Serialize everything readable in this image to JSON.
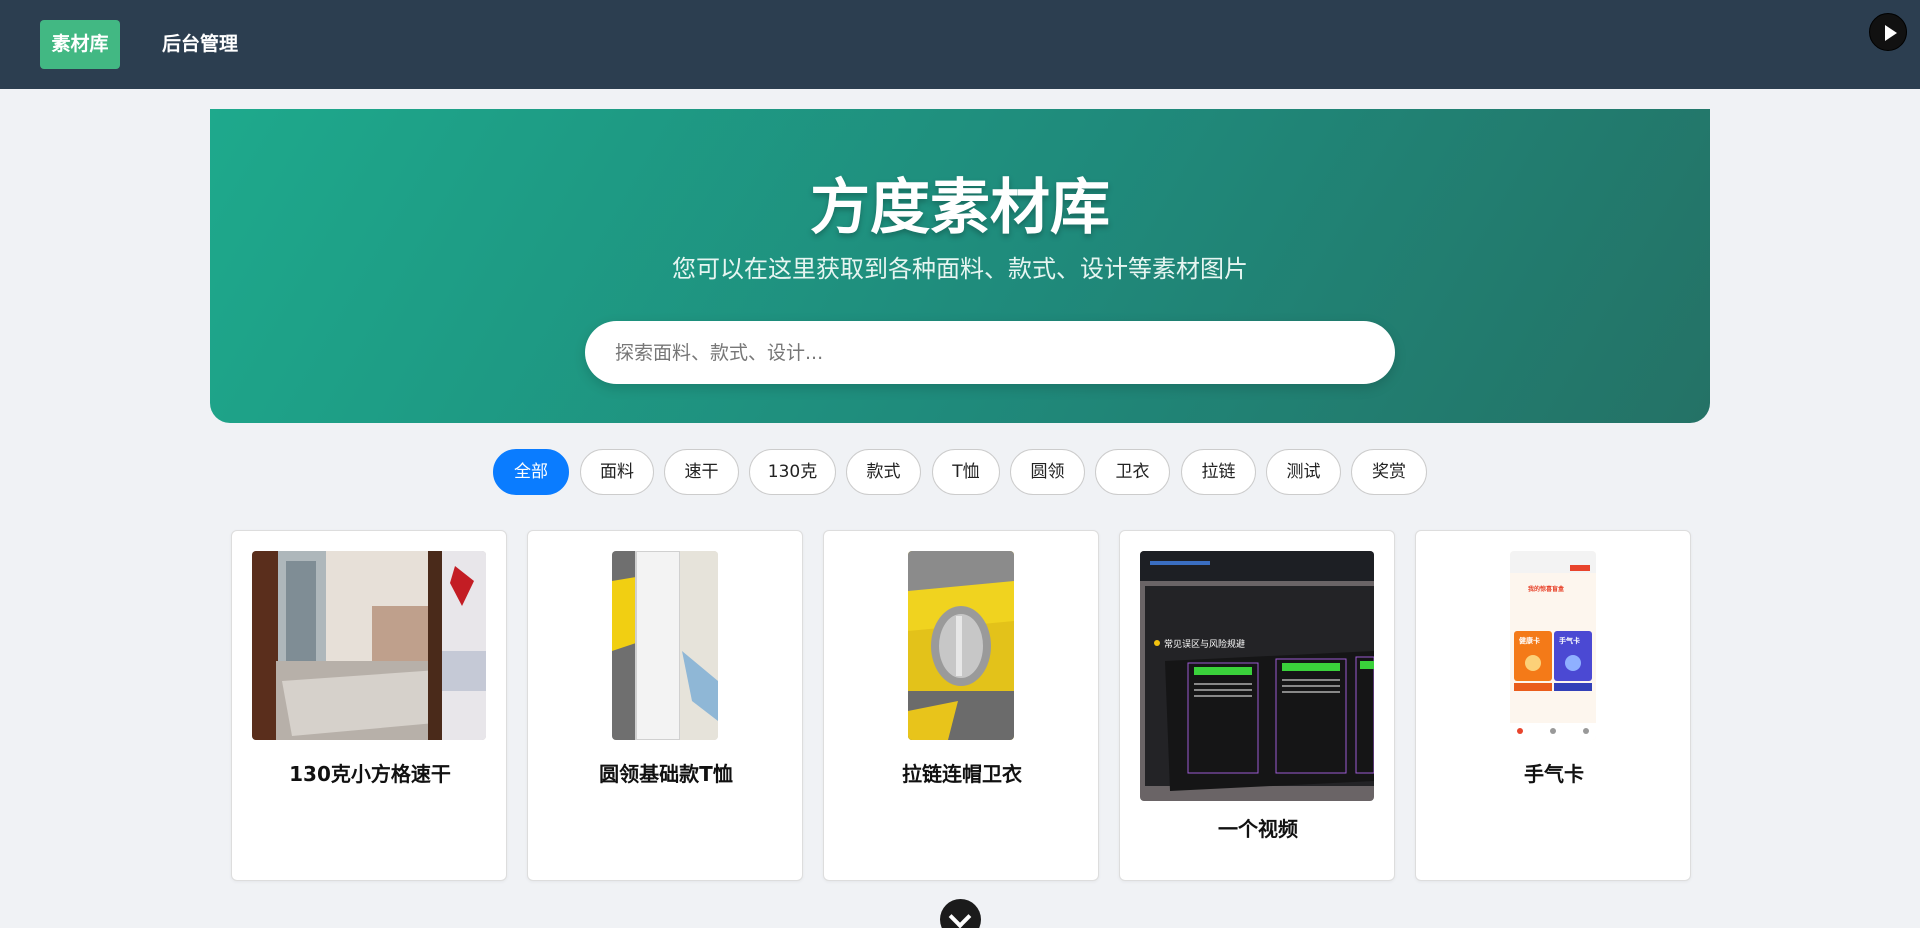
{
  "nav": {
    "items": [
      {
        "label": "素材库",
        "active": true
      },
      {
        "label": "后台管理",
        "active": false
      }
    ],
    "play_icon": "play-icon"
  },
  "hero": {
    "title": "方度素材库",
    "subtitle": "您可以在这里获取到各种面料、款式、设计等素材图片",
    "search_placeholder": "探索面料、款式、设计..."
  },
  "filters": [
    {
      "label": "全部",
      "active": true
    },
    {
      "label": "面料",
      "active": false
    },
    {
      "label": "速干",
      "active": false
    },
    {
      "label": "130克",
      "active": false
    },
    {
      "label": "款式",
      "active": false
    },
    {
      "label": "T恤",
      "active": false
    },
    {
      "label": "圆领",
      "active": false
    },
    {
      "label": "卫衣",
      "active": false
    },
    {
      "label": "拉链",
      "active": false
    },
    {
      "label": "测试",
      "active": false
    },
    {
      "label": "奖赏",
      "active": false
    }
  ],
  "cards": [
    {
      "title": "130克小方格速干"
    },
    {
      "title": "圆领基础款T恤"
    },
    {
      "title": "拉链连帽卫衣"
    },
    {
      "title": "一个视频",
      "image_text": {
        "heading": "常见误区与风险规避"
      }
    },
    {
      "title": "手气卡",
      "image_text": {
        "top": "我的惊喜盲盒",
        "card_a": "健康卡",
        "card_b": "手气卡"
      }
    }
  ],
  "colors": {
    "nav_bg": "#2c3e50",
    "nav_active": "#42b883",
    "hero_start": "#1ea98c",
    "hero_end": "#247266",
    "chip_active": "#0a7cff",
    "page_bg": "#f0f2f5"
  },
  "scroll_icon": "chevron-down-icon"
}
